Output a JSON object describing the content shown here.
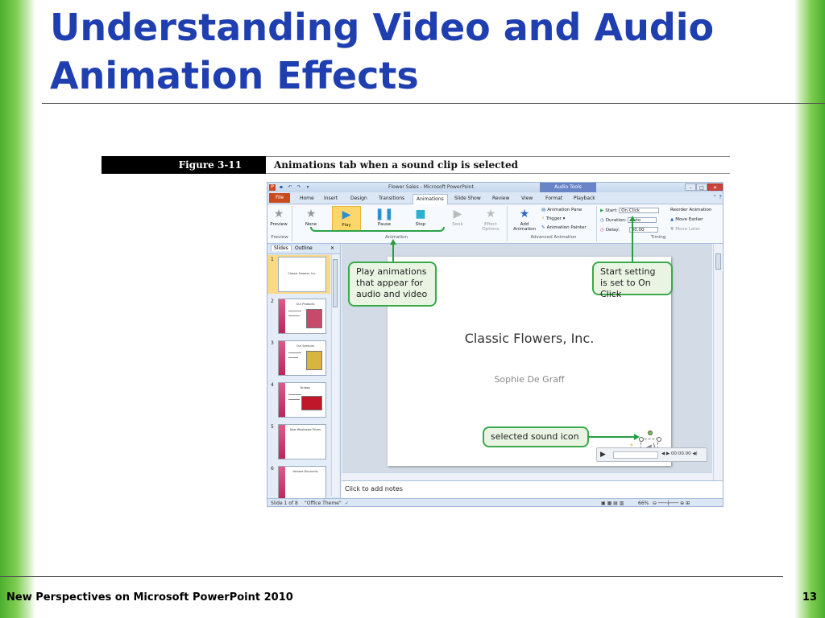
{
  "slide": {
    "title_line1": "Understanding Video and Audio",
    "title_line2": "Animation Effects",
    "footer": "New Perspectives on Microsoft PowerPoint 2010",
    "page_number": "13"
  },
  "figure": {
    "label": "Figure 3-11",
    "caption": "Animations tab when a sound clip is selected"
  },
  "app": {
    "window_title": "Flower Sales - Microsoft PowerPoint",
    "context_tab": "Audio Tools",
    "tabs": [
      "File",
      "Home",
      "Insert",
      "Design",
      "Transitions",
      "Animations",
      "Slide Show",
      "Review",
      "View",
      "Format",
      "Playback"
    ],
    "active_tab": "Animations",
    "ribbon": {
      "preview": "Preview",
      "effects": [
        "None",
        "Play",
        "Pause",
        "Stop",
        "Seek"
      ],
      "effect_options": "Effect Options",
      "add_animation": "Add Animation",
      "animation_pane": "Animation Pane",
      "trigger": "Trigger",
      "animation_painter": "Animation Painter",
      "start_label": "Start:",
      "start_value": "On Click",
      "duration_label": "Duration:",
      "duration_value": "Auto",
      "delay_label": "Delay:",
      "delay_value": "00.00",
      "reorder": "Reorder Animation",
      "move_earlier": "Move Earlier",
      "move_later": "Move Later",
      "groups": [
        "Preview",
        "Animation",
        "Advanced Animation",
        "Timing"
      ]
    },
    "panel": {
      "tab_slides": "Slides",
      "tab_outline": "Outline",
      "thumbs": [
        {
          "num": "1",
          "title": "Classic Flowers, Inc."
        },
        {
          "num": "2",
          "title": "Our Products"
        },
        {
          "num": "3",
          "title": "Our Services"
        },
        {
          "num": "4",
          "title": "Bridals"
        },
        {
          "num": "5",
          "title": "New Wholesale Prices"
        },
        {
          "num": "6",
          "title": "Volume Discounts"
        }
      ]
    },
    "slide_title": "Classic Flowers, Inc.",
    "slide_subtitle": "Sophie De Graff",
    "player_time": "00:00.00",
    "notes_placeholder": "Click to add notes",
    "status": {
      "slide_of": "Slide 1 of 8",
      "theme": "\"Office Theme\"",
      "zoom": "66%"
    }
  },
  "callouts": {
    "play": "Play animations that appear for audio and video",
    "start": "Start setting is set to On Click",
    "sound": "selected sound icon"
  },
  "colors": {
    "title_blue": "#1f3fb0",
    "callout_green": "#3aa94a",
    "ribbon_highlight": "#fdd76a"
  }
}
